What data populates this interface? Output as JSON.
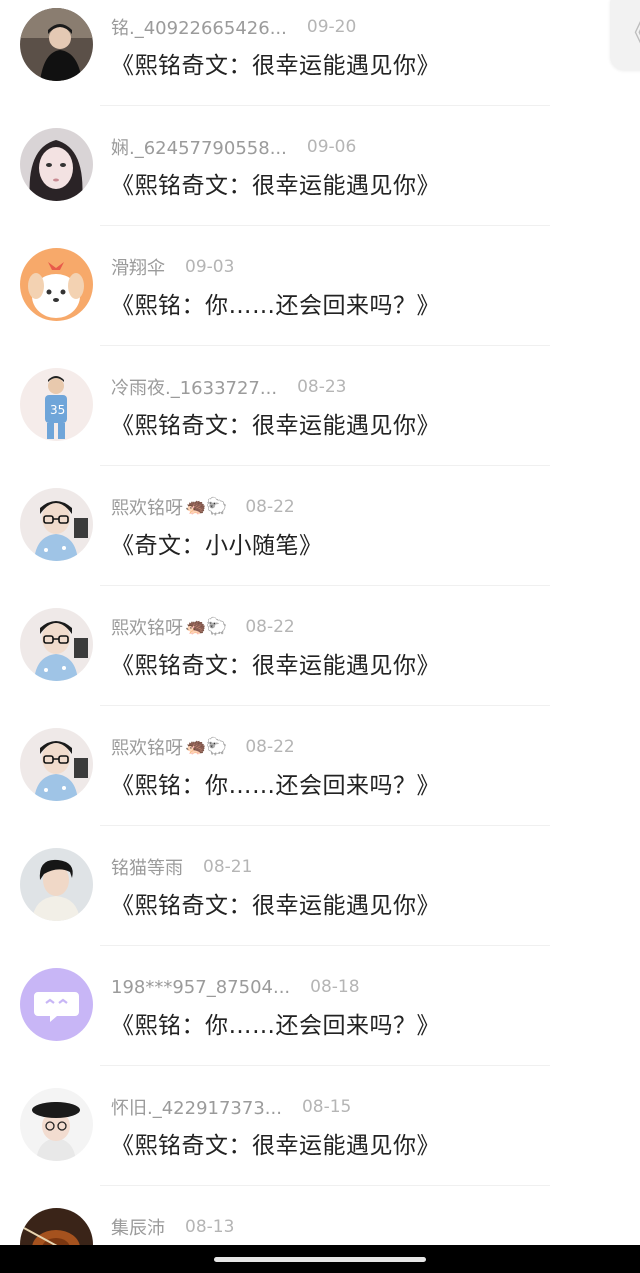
{
  "side_tab": {
    "icon": "chevron-left-icon",
    "label": "《"
  },
  "comments": [
    {
      "name": "铭._40922665426...",
      "emoji": "",
      "date": "09-20",
      "title": "《熙铭奇文：很幸运能遇见你》",
      "avatar": "dark-portrait"
    },
    {
      "name": "娴._62457790558...",
      "emoji": "",
      "date": "09-06",
      "title": "《熙铭奇文：很幸运能遇见你》",
      "avatar": "girl-face"
    },
    {
      "name": "滑翔伞",
      "emoji": "",
      "date": "09-03",
      "title": "《熙铭：你……还会回来吗？》",
      "avatar": "orange-puppy"
    },
    {
      "name": "冷雨夜._1633727...",
      "emoji": "",
      "date": "08-23",
      "title": "《熙铭奇文：很幸运能遇见你》",
      "avatar": "blue-jersey"
    },
    {
      "name": "熙欢铭呀",
      "emoji": "🦔🐑",
      "date": "08-22",
      "title": "《奇文：小小随笔》",
      "avatar": "glasses-boy"
    },
    {
      "name": "熙欢铭呀",
      "emoji": "🦔🐑",
      "date": "08-22",
      "title": "《熙铭奇文：很幸运能遇见你》",
      "avatar": "glasses-boy"
    },
    {
      "name": "熙欢铭呀",
      "emoji": "🦔🐑",
      "date": "08-22",
      "title": "《熙铭：你……还会回来吗？》",
      "avatar": "glasses-boy"
    },
    {
      "name": "铭猫等雨",
      "emoji": "",
      "date": "08-21",
      "title": "《熙铭奇文：很幸运能遇见你》",
      "avatar": "boy-portrait"
    },
    {
      "name": "198***957_87504...",
      "emoji": "",
      "date": "08-18",
      "title": "《熙铭：你……还会回来吗？》",
      "avatar": "purple-chat"
    },
    {
      "name": "怀旧._422917373...",
      "emoji": "",
      "date": "08-15",
      "title": "《熙铭奇文：很幸运能遇见你》",
      "avatar": "hat-boy"
    },
    {
      "name": "集辰沛",
      "emoji": "",
      "date": "08-13",
      "title": "",
      "avatar": "violin"
    }
  ]
}
